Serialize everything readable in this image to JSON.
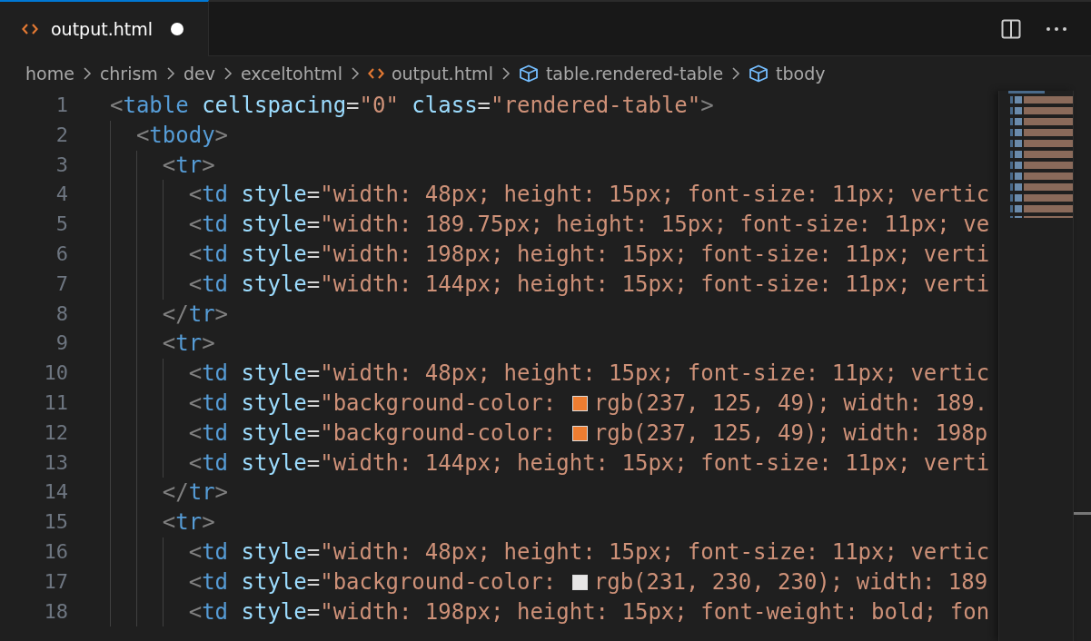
{
  "tab": {
    "label": "output.html",
    "modified": true,
    "selected": true
  },
  "breadcrumbs": [
    {
      "label": "home",
      "kind": "folder"
    },
    {
      "label": "chrism",
      "kind": "folder"
    },
    {
      "label": "dev",
      "kind": "folder"
    },
    {
      "label": "exceltohtml",
      "kind": "folder"
    },
    {
      "label": "output.html",
      "kind": "file"
    },
    {
      "label": "table.rendered-table",
      "kind": "symbol"
    },
    {
      "label": "tbody",
      "kind": "symbol"
    }
  ],
  "lines": [
    {
      "number": "1",
      "tokens": [
        {
          "kind": "punct",
          "text": "<"
        },
        {
          "kind": "tag",
          "text": "table"
        },
        {
          "kind": "attr",
          "text": " cellspacing"
        },
        {
          "kind": "eq",
          "text": "="
        },
        {
          "kind": "string",
          "text": "\"0\""
        },
        {
          "kind": "attr",
          "text": " class"
        },
        {
          "kind": "eq",
          "text": "="
        },
        {
          "kind": "string",
          "text": "\"rendered-table\""
        },
        {
          "kind": "punct",
          "text": ">"
        }
      ],
      "children": [
        {
          "number": "2",
          "tokens": [
            {
              "kind": "punct",
              "text": "<"
            },
            {
              "kind": "tag",
              "text": "tbody"
            },
            {
              "kind": "punct",
              "text": ">"
            }
          ],
          "children": [
            {
              "number": "3",
              "tokens": [
                {
                  "kind": "punct",
                  "text": "<"
                },
                {
                  "kind": "tag",
                  "text": "tr"
                },
                {
                  "kind": "punct",
                  "text": ">"
                }
              ],
              "children": [
                {
                  "number": "4",
                  "tokens": [
                    {
                      "kind": "punct",
                      "text": "<"
                    },
                    {
                      "kind": "tag",
                      "text": "td"
                    },
                    {
                      "kind": "attr",
                      "text": " style"
                    },
                    {
                      "kind": "eq",
                      "text": "="
                    },
                    {
                      "kind": "string",
                      "text": "\"width: 48px; height: 15px; font-size: 11px; vertic"
                    }
                  ]
                },
                {
                  "number": "5",
                  "tokens": [
                    {
                      "kind": "punct",
                      "text": "<"
                    },
                    {
                      "kind": "tag",
                      "text": "td"
                    },
                    {
                      "kind": "attr",
                      "text": " style"
                    },
                    {
                      "kind": "eq",
                      "text": "="
                    },
                    {
                      "kind": "string",
                      "text": "\"width: 189.75px; height: 15px; font-size: 11px; ve"
                    }
                  ]
                },
                {
                  "number": "6",
                  "tokens": [
                    {
                      "kind": "punct",
                      "text": "<"
                    },
                    {
                      "kind": "tag",
                      "text": "td"
                    },
                    {
                      "kind": "attr",
                      "text": " style"
                    },
                    {
                      "kind": "eq",
                      "text": "="
                    },
                    {
                      "kind": "string",
                      "text": "\"width: 198px; height: 15px; font-size: 11px; verti"
                    }
                  ]
                },
                {
                  "number": "7",
                  "tokens": [
                    {
                      "kind": "punct",
                      "text": "<"
                    },
                    {
                      "kind": "tag",
                      "text": "td"
                    },
                    {
                      "kind": "attr",
                      "text": " style"
                    },
                    {
                      "kind": "eq",
                      "text": "="
                    },
                    {
                      "kind": "string",
                      "text": "\"width: 144px; height: 15px; font-size: 11px; verti"
                    }
                  ]
                }
              ]
            },
            {
              "number": "8",
              "tokens": [
                {
                  "kind": "punct",
                  "text": "</"
                },
                {
                  "kind": "tag",
                  "text": "tr"
                },
                {
                  "kind": "punct",
                  "text": ">"
                }
              ]
            },
            {
              "number": "9",
              "tokens": [
                {
                  "kind": "punct",
                  "text": "<"
                },
                {
                  "kind": "tag",
                  "text": "tr"
                },
                {
                  "kind": "punct",
                  "text": ">"
                }
              ],
              "children": [
                {
                  "number": "10",
                  "tokens": [
                    {
                      "kind": "punct",
                      "text": "<"
                    },
                    {
                      "kind": "tag",
                      "text": "td"
                    },
                    {
                      "kind": "attr",
                      "text": " style"
                    },
                    {
                      "kind": "eq",
                      "text": "="
                    },
                    {
                      "kind": "string",
                      "text": "\"width: 48px; height: 15px; font-size: 11px; vertic"
                    }
                  ]
                },
                {
                  "number": "11",
                  "tokens": [
                    {
                      "kind": "punct",
                      "text": "<"
                    },
                    {
                      "kind": "tag",
                      "text": "td"
                    },
                    {
                      "kind": "attr",
                      "text": " style"
                    },
                    {
                      "kind": "eq",
                      "text": "="
                    },
                    {
                      "kind": "string",
                      "text": "\"background-color: "
                    },
                    {
                      "kind": "swatch",
                      "color": "#ed7d31"
                    },
                    {
                      "kind": "string",
                      "text": "rgb(237, 125, 49); width: 189."
                    }
                  ]
                },
                {
                  "number": "12",
                  "tokens": [
                    {
                      "kind": "punct",
                      "text": "<"
                    },
                    {
                      "kind": "tag",
                      "text": "td"
                    },
                    {
                      "kind": "attr",
                      "text": " style"
                    },
                    {
                      "kind": "eq",
                      "text": "="
                    },
                    {
                      "kind": "string",
                      "text": "\"background-color: "
                    },
                    {
                      "kind": "swatch",
                      "color": "#ed7d31"
                    },
                    {
                      "kind": "string",
                      "text": "rgb(237, 125, 49); width: 198p"
                    }
                  ]
                },
                {
                  "number": "13",
                  "tokens": [
                    {
                      "kind": "punct",
                      "text": "<"
                    },
                    {
                      "kind": "tag",
                      "text": "td"
                    },
                    {
                      "kind": "attr",
                      "text": " style"
                    },
                    {
                      "kind": "eq",
                      "text": "="
                    },
                    {
                      "kind": "string",
                      "text": "\"width: 144px; height: 15px; font-size: 11px; verti"
                    }
                  ]
                }
              ]
            },
            {
              "number": "14",
              "tokens": [
                {
                  "kind": "punct",
                  "text": "</"
                },
                {
                  "kind": "tag",
                  "text": "tr"
                },
                {
                  "kind": "punct",
                  "text": ">"
                }
              ]
            },
            {
              "number": "15",
              "tokens": [
                {
                  "kind": "punct",
                  "text": "<"
                },
                {
                  "kind": "tag",
                  "text": "tr"
                },
                {
                  "kind": "punct",
                  "text": ">"
                }
              ],
              "children": [
                {
                  "number": "16",
                  "tokens": [
                    {
                      "kind": "punct",
                      "text": "<"
                    },
                    {
                      "kind": "tag",
                      "text": "td"
                    },
                    {
                      "kind": "attr",
                      "text": " style"
                    },
                    {
                      "kind": "eq",
                      "text": "="
                    },
                    {
                      "kind": "string",
                      "text": "\"width: 48px; height: 15px; font-size: 11px; vertic"
                    }
                  ]
                },
                {
                  "number": "17",
                  "tokens": [
                    {
                      "kind": "punct",
                      "text": "<"
                    },
                    {
                      "kind": "tag",
                      "text": "td"
                    },
                    {
                      "kind": "attr",
                      "text": " style"
                    },
                    {
                      "kind": "eq",
                      "text": "="
                    },
                    {
                      "kind": "string",
                      "text": "\"background-color: "
                    },
                    {
                      "kind": "swatch",
                      "color": "#e7e6e6"
                    },
                    {
                      "kind": "string",
                      "text": "rgb(231, 230, 230); width: 189"
                    }
                  ]
                },
                {
                  "number": "18",
                  "tokens": [
                    {
                      "kind": "punct",
                      "text": "<"
                    },
                    {
                      "kind": "tag",
                      "text": "td"
                    },
                    {
                      "kind": "attr",
                      "text": " style"
                    },
                    {
                      "kind": "eq",
                      "text": "="
                    },
                    {
                      "kind": "string",
                      "text": "\"width: 198px; height: 15px; font-weight: bold; fon"
                    }
                  ]
                }
              ]
            }
          ]
        }
      ]
    }
  ]
}
